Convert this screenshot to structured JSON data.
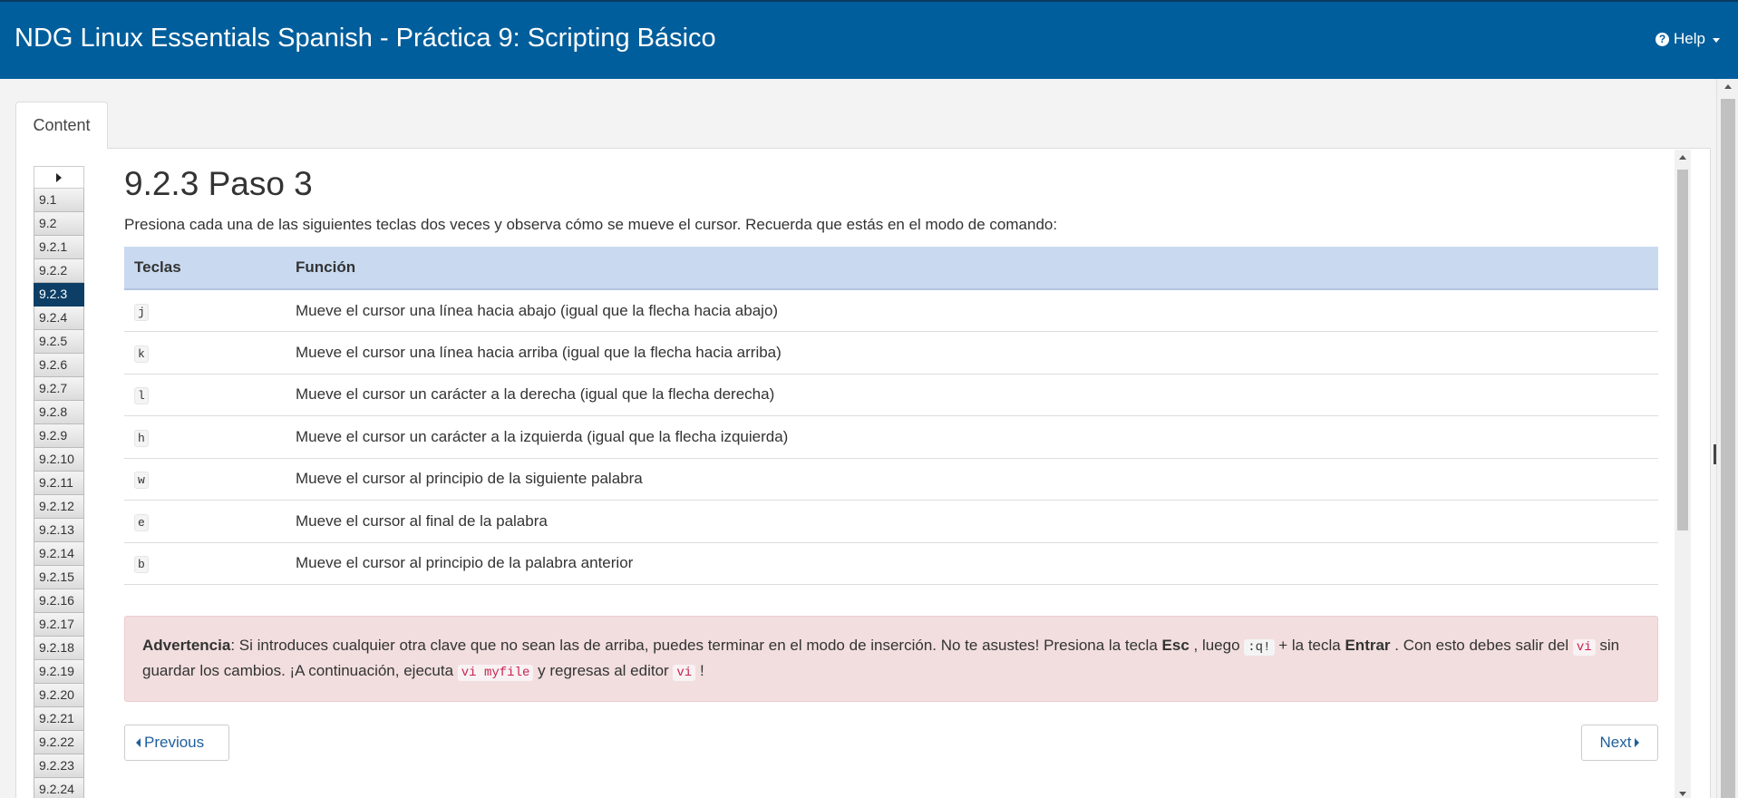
{
  "header": {
    "title": "NDG Linux Essentials Spanish - Práctica 9: Scripting Básico",
    "help_label": "Help",
    "help_icon": "question-circle-icon"
  },
  "tabs": [
    {
      "label": "Content"
    }
  ],
  "sidenav": {
    "items": [
      "9.1",
      "9.2",
      "9.2.1",
      "9.2.2",
      "9.2.3",
      "9.2.4",
      "9.2.5",
      "9.2.6",
      "9.2.7",
      "9.2.8",
      "9.2.9",
      "9.2.10",
      "9.2.11",
      "9.2.12",
      "9.2.13",
      "9.2.14",
      "9.2.15",
      "9.2.16",
      "9.2.17",
      "9.2.18",
      "9.2.19",
      "9.2.20",
      "9.2.21",
      "9.2.22",
      "9.2.23",
      "9.2.24"
    ],
    "active": "9.2.3"
  },
  "main": {
    "title": "9.2.3 Paso 3",
    "intro": "Presiona cada una de las siguientes teclas dos veces y observa cómo se mueve el cursor. Recuerda que estás en el modo de comando:",
    "table": {
      "headers": [
        "Teclas",
        "Función"
      ],
      "rows": [
        {
          "key": "j",
          "desc": "Mueve el cursor una línea hacia abajo (igual que la flecha hacia abajo)"
        },
        {
          "key": "k",
          "desc": "Mueve el cursor una línea hacia arriba (igual que la flecha hacia arriba)"
        },
        {
          "key": "l",
          "desc": "Mueve el cursor un carácter a la derecha (igual que la flecha derecha)"
        },
        {
          "key": "h",
          "desc": "Mueve el cursor un carácter a la izquierda (igual que la flecha izquierda)"
        },
        {
          "key": "w",
          "desc": "Mueve el cursor al principio de la siguiente palabra"
        },
        {
          "key": "e",
          "desc": "Mueve el cursor al final de la palabra"
        },
        {
          "key": "b",
          "desc": "Mueve el cursor al principio de la palabra anterior"
        }
      ]
    },
    "warning": {
      "label": "Advertencia",
      "t1": ": Si introduces cualquier otra clave que no sean las de arriba, puedes terminar en el modo de inserción. No te asustes! Presiona la tecla ",
      "b1": "Esc",
      "t2": " , luego ",
      "c1": ":q!",
      "t3": " + la tecla ",
      "b2": "Entrar",
      "t4": " . Con esto debes salir del ",
      "c2": "vi",
      "t5": " sin guardar los cambios. ¡A continuación, ejecuta ",
      "c3": "vi myfile",
      "t6": " y regresas al editor ",
      "c4": "vi",
      "t7": " !"
    },
    "pager": {
      "previous": "Previous",
      "next": "Next"
    }
  },
  "colors": {
    "header_bg": "#005e9c",
    "active_nav": "#0d3f66",
    "table_header": "#c9daf0",
    "warning_bg": "#f2dede"
  }
}
